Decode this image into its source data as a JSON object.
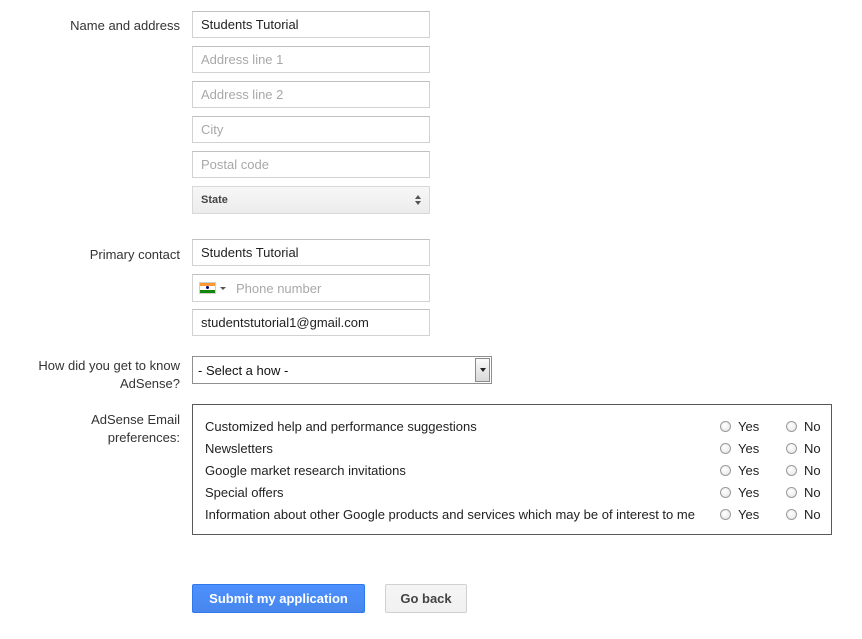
{
  "name_address": {
    "label": "Name and address",
    "name_value": "Students Tutorial",
    "address1_placeholder": "Address line 1",
    "address2_placeholder": "Address line 2",
    "city_placeholder": "City",
    "postal_placeholder": "Postal code",
    "state_label": "State"
  },
  "primary_contact": {
    "label": "Primary contact",
    "name_value": "Students Tutorial",
    "phone_placeholder": "Phone number",
    "country_flag": "india-flag-icon",
    "email_value": "studentstutorial1@gmail.com"
  },
  "how": {
    "label_line1": "How did you get to know",
    "label_line2": "AdSense?",
    "selected": "- Select a how -"
  },
  "email_prefs": {
    "label_line1": "AdSense Email",
    "label_line2": "preferences:",
    "yes_label": "Yes",
    "no_label": "No",
    "rows": [
      {
        "label": "Customized help and performance suggestions"
      },
      {
        "label": "Newsletters"
      },
      {
        "label": "Google market research invitations"
      },
      {
        "label": "Special offers"
      },
      {
        "label": "Information about other Google products and services which may be of interest to me"
      }
    ]
  },
  "actions": {
    "submit_label": "Submit my application",
    "back_label": "Go back"
  },
  "colors": {
    "primary_button": "#4d90fe",
    "secondary_button": "#f5f5f5",
    "border": "#d2d2d2"
  }
}
